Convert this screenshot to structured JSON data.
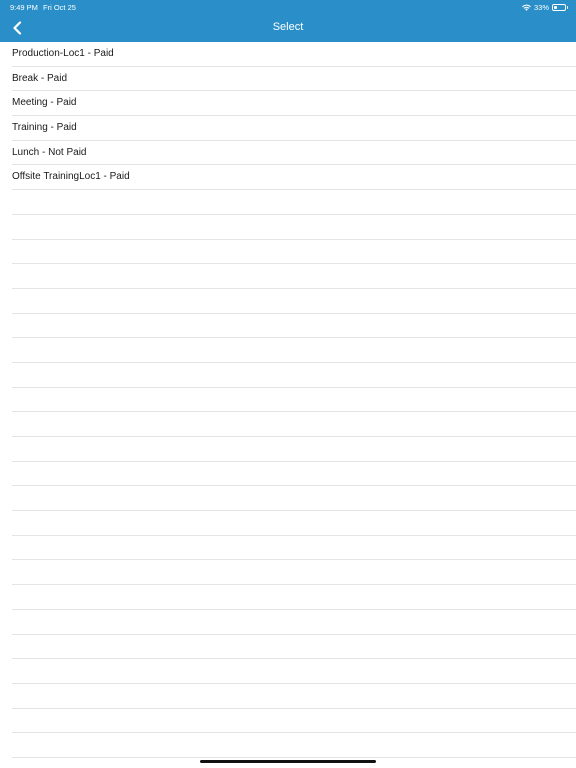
{
  "status_bar": {
    "time": "9:49 PM",
    "date": "Fri Oct 25",
    "battery_percent": "33%",
    "battery_level": 0.33
  },
  "header": {
    "title": "Select",
    "back_icon": "chevron-left-icon",
    "background_color": "#2a8fc9"
  },
  "items": [
    {
      "label": "Production-Loc1 - Paid"
    },
    {
      "label": "Break - Paid"
    },
    {
      "label": "Meeting - Paid"
    },
    {
      "label": "Training - Paid"
    },
    {
      "label": "Lunch - Not Paid"
    },
    {
      "label": "Offsite TrainingLoc1 - Paid"
    }
  ]
}
